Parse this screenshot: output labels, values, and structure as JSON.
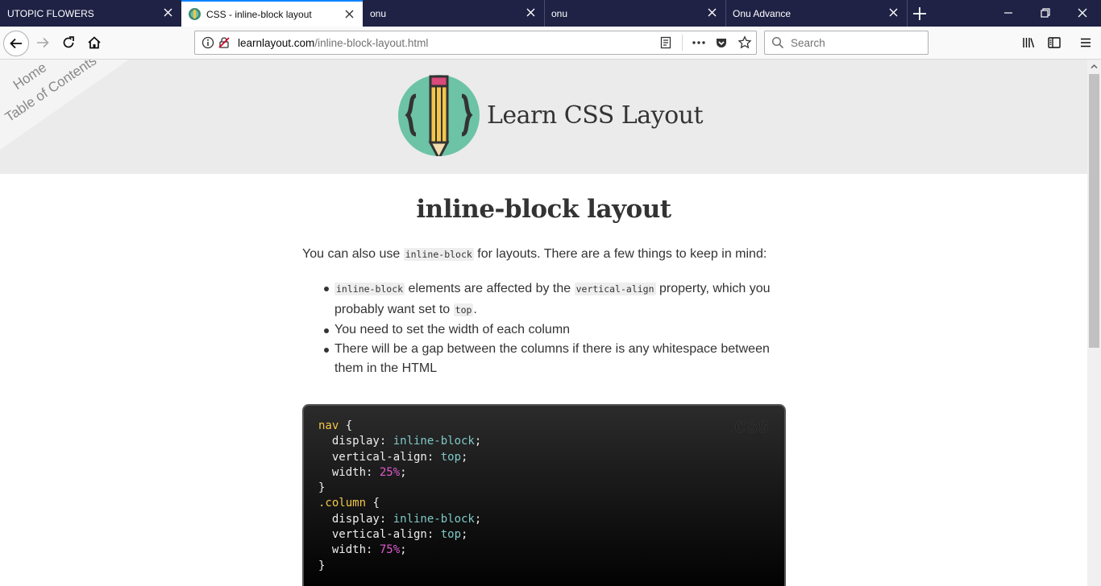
{
  "tabs": [
    {
      "title": "UTOPIC FLOWERS"
    },
    {
      "title": "CSS - inline-block layout"
    },
    {
      "title": "onu"
    },
    {
      "title": "onu"
    },
    {
      "title": "Onu Advance"
    }
  ],
  "urlbar": {
    "domain": "learnlayout.com",
    "path": "/inline-block-layout.html"
  },
  "search": {
    "placeholder": "Search"
  },
  "site": {
    "title": "Learn CSS Layout",
    "nav": {
      "home": "Home",
      "toc": "Table of Contents"
    }
  },
  "page": {
    "heading": "inline-block layout",
    "intro": {
      "before": "You can also use ",
      "code": "inline-block",
      "after": " for layouts. There are a few things to keep in mind:"
    },
    "bullets": [
      {
        "code1": "inline-block",
        "text1": " elements are affected by the ",
        "code2": "vertical-align",
        "text2": " property, which you probably want set to ",
        "code3": "top",
        "text3": "."
      },
      {
        "text": "You need to set the width of each column"
      },
      {
        "text": "There will be a gap between the columns if there is any whitespace between them in the HTML"
      }
    ]
  },
  "code": {
    "language": "CSS",
    "lines": [
      {
        "sel": "nav",
        "rest": " {"
      },
      {
        "prop": "  display: ",
        "val": "inline-block",
        "end": ";"
      },
      {
        "prop": "  vertical-align: ",
        "val": "top",
        "end": ";"
      },
      {
        "prop": "  width: ",
        "num": "25%",
        "end": ";"
      },
      {
        "plain": "}"
      },
      {
        "sel": ".column",
        "rest": " {"
      },
      {
        "prop": "  display: ",
        "val": "inline-block",
        "end": ";"
      },
      {
        "prop": "  vertical-align: ",
        "val": "top",
        "end": ";"
      },
      {
        "prop": "  width: ",
        "num": "75%",
        "end": ";"
      },
      {
        "plain": "}"
      }
    ]
  },
  "colors": {
    "accent": "#0a84ff",
    "tabstrip": "#1f2245",
    "logo_teal": "#6cc3a5",
    "code_yellow": "#f3c64a",
    "code_teal": "#7ec9c6",
    "code_magenta": "#e05ad1"
  }
}
